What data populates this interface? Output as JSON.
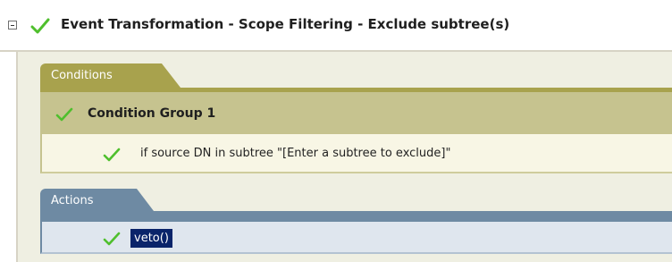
{
  "header": {
    "title": "Event Transformation - Scope Filtering - Exclude subtree(s)",
    "toggle_icon": "collapse-minus-icon",
    "status_icon": "check-icon"
  },
  "conditions": {
    "tab_label": "Conditions",
    "group": {
      "title": "Condition Group 1",
      "status_icon": "check-icon"
    },
    "items": [
      {
        "text": "if source DN in subtree \"[Enter a subtree to exclude]\"",
        "status_icon": "check-icon"
      }
    ]
  },
  "actions": {
    "tab_label": "Actions",
    "items": [
      {
        "text": "veto()",
        "status_icon": "check-icon",
        "selected": true
      }
    ]
  },
  "colors": {
    "check_green": "#4fbf2d",
    "conditions_tab": "#a8a24d",
    "conditions_group_bg": "#c6c38f",
    "actions_tab": "#6e8aa3",
    "selection_bg": "#0a246a"
  }
}
